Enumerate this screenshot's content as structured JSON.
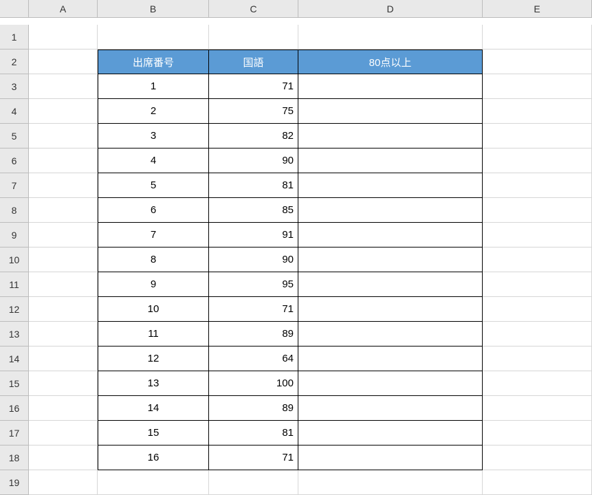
{
  "columns": [
    "",
    "A",
    "B",
    "C",
    "D",
    "E"
  ],
  "row_headers": [
    "1",
    "2",
    "3",
    "4",
    "5",
    "6",
    "7",
    "8",
    "9",
    "10",
    "11",
    "12",
    "13",
    "14",
    "15",
    "16",
    "17",
    "18",
    "19"
  ],
  "table": {
    "headers": {
      "b": "出席番号",
      "c": "国語",
      "d": "80点以上"
    },
    "rows": [
      {
        "id": "1",
        "score": "71",
        "flag": ""
      },
      {
        "id": "2",
        "score": "75",
        "flag": ""
      },
      {
        "id": "3",
        "score": "82",
        "flag": ""
      },
      {
        "id": "4",
        "score": "90",
        "flag": ""
      },
      {
        "id": "5",
        "score": "81",
        "flag": ""
      },
      {
        "id": "6",
        "score": "85",
        "flag": ""
      },
      {
        "id": "7",
        "score": "91",
        "flag": ""
      },
      {
        "id": "8",
        "score": "90",
        "flag": ""
      },
      {
        "id": "9",
        "score": "95",
        "flag": ""
      },
      {
        "id": "10",
        "score": "71",
        "flag": ""
      },
      {
        "id": "11",
        "score": "89",
        "flag": ""
      },
      {
        "id": "12",
        "score": "64",
        "flag": ""
      },
      {
        "id": "13",
        "score": "100",
        "flag": ""
      },
      {
        "id": "14",
        "score": "89",
        "flag": ""
      },
      {
        "id": "15",
        "score": "81",
        "flag": ""
      },
      {
        "id": "16",
        "score": "71",
        "flag": ""
      }
    ]
  },
  "chart_data": {
    "type": "table",
    "columns": [
      "出席番号",
      "国語",
      "80点以上"
    ],
    "rows": [
      [
        1,
        71,
        null
      ],
      [
        2,
        75,
        null
      ],
      [
        3,
        82,
        null
      ],
      [
        4,
        90,
        null
      ],
      [
        5,
        81,
        null
      ],
      [
        6,
        85,
        null
      ],
      [
        7,
        91,
        null
      ],
      [
        8,
        90,
        null
      ],
      [
        9,
        95,
        null
      ],
      [
        10,
        71,
        null
      ],
      [
        11,
        89,
        null
      ],
      [
        12,
        64,
        null
      ],
      [
        13,
        100,
        null
      ],
      [
        14,
        89,
        null
      ],
      [
        15,
        81,
        null
      ],
      [
        16,
        71,
        null
      ]
    ]
  }
}
